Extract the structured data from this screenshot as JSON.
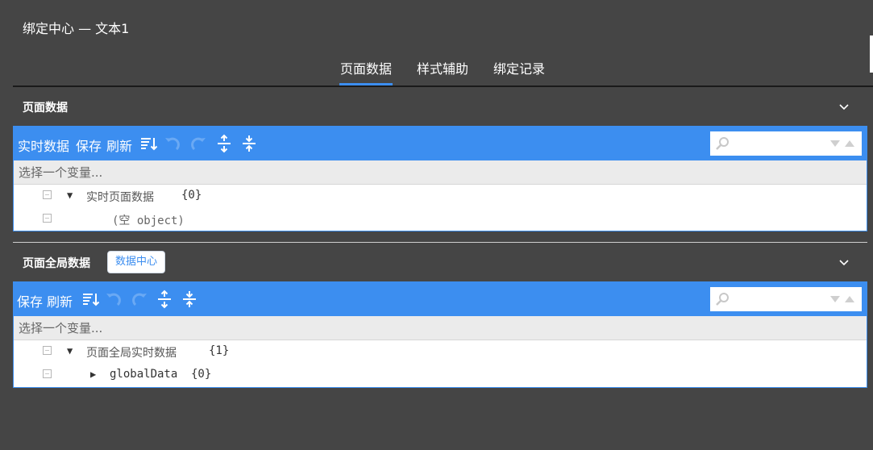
{
  "window": {
    "title": "绑定中心 — 文本1"
  },
  "tabs": [
    {
      "label": "页面数据",
      "active": true
    },
    {
      "label": "样式辅助",
      "active": false
    },
    {
      "label": "绑定记录",
      "active": false
    }
  ],
  "page_data": {
    "title": "页面数据",
    "toolbar": {
      "realtime": "实时数据",
      "save": "保存",
      "refresh": "刷新"
    },
    "variable_placeholder": "选择一个变量...",
    "tree": [
      {
        "label": "实时页面数据",
        "count": "{0}",
        "expanded": true
      },
      {
        "label": "(空 object)"
      }
    ]
  },
  "global_data": {
    "title": "页面全局数据",
    "hub_button": "数据中心",
    "toolbar": {
      "save": "保存",
      "refresh": "刷新"
    },
    "variable_placeholder": "选择一个变量...",
    "tree": [
      {
        "label": "页面全局实时数据",
        "count": "{1}",
        "expanded": true
      },
      {
        "label": "globalData",
        "count": "{0}",
        "expanded": false
      }
    ]
  },
  "icons": {
    "sort": "sort-icon",
    "undo": "undo-icon",
    "redo": "redo-icon",
    "expand_all": "expand-all-icon",
    "collapse_all": "collapse-all-icon",
    "search": "search-icon",
    "prev": "prev-match-icon",
    "next": "next-match-icon",
    "chevron": "chevron-down-icon"
  },
  "colors": {
    "background": "#454545",
    "accent": "#3c8ef0",
    "panel": "#ffffff",
    "select_bg": "#ebebeb"
  }
}
